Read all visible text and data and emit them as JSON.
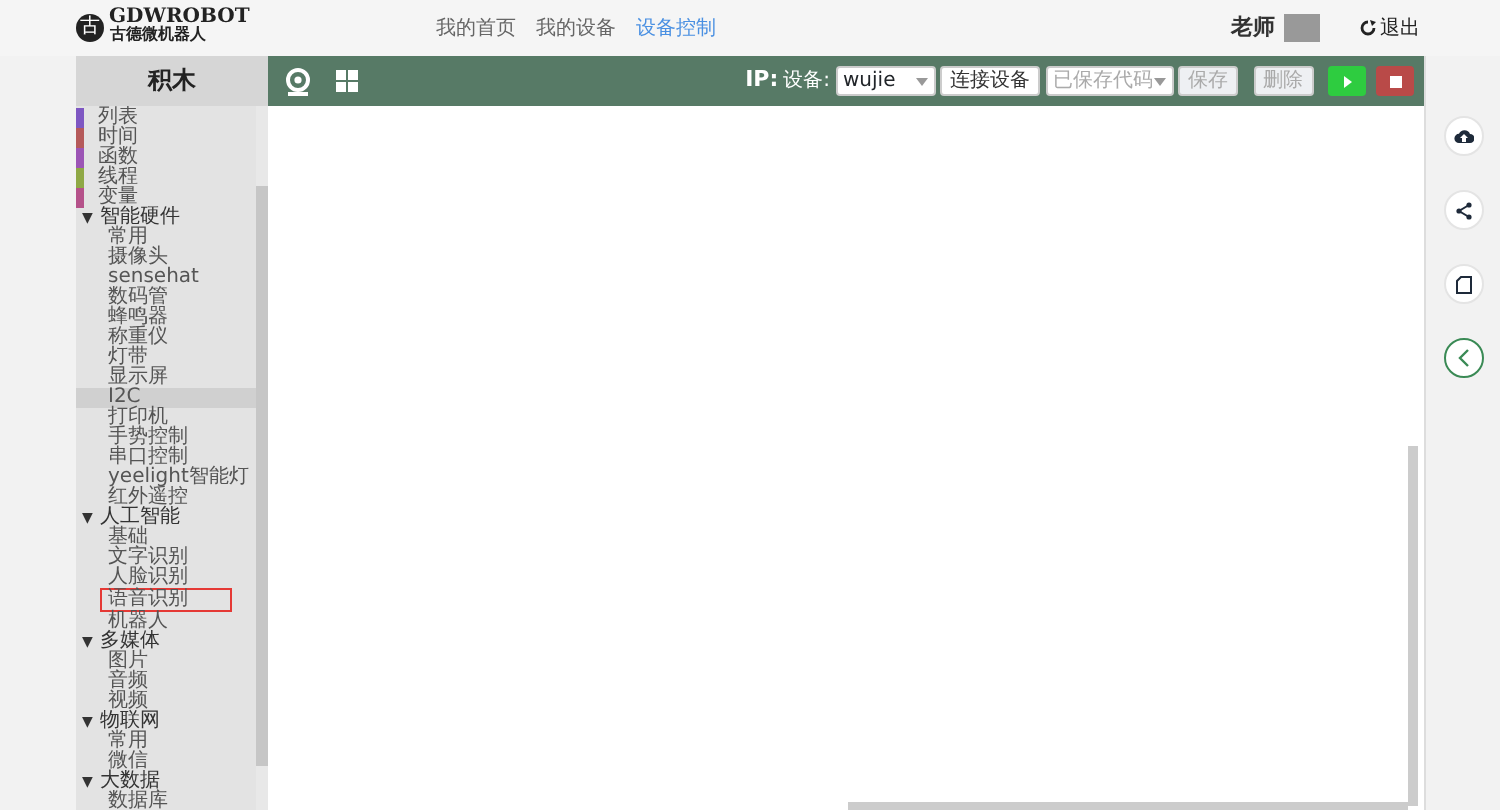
{
  "header": {
    "logo_text": "GDWROBOT",
    "logo_subtitle": "古德微机器人",
    "logo_glyph": "古",
    "nav": [
      {
        "label": "我的首页",
        "selected": false
      },
      {
        "label": "我的设备",
        "selected": false
      },
      {
        "label": "设备控制",
        "selected": true
      }
    ],
    "user": "老师",
    "logout": "退出"
  },
  "panel_title": "积木",
  "toolbar": {
    "ip_label": "IP:",
    "device_label": "设备:",
    "device_value": "wujie",
    "connect": "连接设备",
    "saved_code_placeholder": "已保存代码",
    "save": {
      "label": "保存",
      "disabled": true
    },
    "delete": {
      "label": "删除",
      "disabled": true
    }
  },
  "categories": [
    {
      "label": "列表",
      "color": "#7e57c2"
    },
    {
      "label": "时间",
      "color": "#b55a5a"
    },
    {
      "label": "函数",
      "color": "#9c55b5"
    },
    {
      "label": "线程",
      "color": "#8fa845"
    },
    {
      "label": "变量",
      "color": "#b5528a"
    }
  ],
  "groups": [
    {
      "label": "智能硬件",
      "expanded": true,
      "children": [
        {
          "label": "常用",
          "selected": false,
          "highlighted": false
        },
        {
          "label": "摄像头",
          "selected": false,
          "highlighted": false
        },
        {
          "label": "sensehat",
          "selected": false,
          "highlighted": false
        },
        {
          "label": "数码管",
          "selected": false,
          "highlighted": false
        },
        {
          "label": "蜂鸣器",
          "selected": false,
          "highlighted": false
        },
        {
          "label": "称重仪",
          "selected": false,
          "highlighted": false
        },
        {
          "label": "灯带",
          "selected": false,
          "highlighted": false
        },
        {
          "label": "显示屏",
          "selected": false,
          "highlighted": false
        },
        {
          "label": "I2C",
          "selected": true,
          "highlighted": false
        },
        {
          "label": "打印机",
          "selected": false,
          "highlighted": false
        },
        {
          "label": "手势控制",
          "selected": false,
          "highlighted": false
        },
        {
          "label": "串口控制",
          "selected": false,
          "highlighted": false
        },
        {
          "label": "yeelight智能灯",
          "selected": false,
          "highlighted": false
        },
        {
          "label": "红外遥控",
          "selected": false,
          "highlighted": false
        }
      ]
    },
    {
      "label": "人工智能",
      "expanded": true,
      "children": [
        {
          "label": "基础",
          "selected": false,
          "highlighted": false
        },
        {
          "label": "文字识别",
          "selected": false,
          "highlighted": false
        },
        {
          "label": "人脸识别",
          "selected": false,
          "highlighted": false
        },
        {
          "label": "语音识别",
          "selected": false,
          "highlighted": true
        },
        {
          "label": "机器人",
          "selected": false,
          "highlighted": false
        }
      ]
    },
    {
      "label": "多媒体",
      "expanded": true,
      "children": [
        {
          "label": "图片",
          "selected": false,
          "highlighted": false
        },
        {
          "label": "音频",
          "selected": false,
          "highlighted": false
        },
        {
          "label": "视频",
          "selected": false,
          "highlighted": false
        }
      ]
    },
    {
      "label": "物联网",
      "expanded": true,
      "children": [
        {
          "label": "常用",
          "selected": false,
          "highlighted": false
        },
        {
          "label": "微信",
          "selected": false,
          "highlighted": false
        }
      ]
    },
    {
      "label": "大数据",
      "expanded": true,
      "children": [
        {
          "label": "数据库",
          "selected": false,
          "highlighted": false
        }
      ]
    }
  ],
  "group_toggle": "▼"
}
